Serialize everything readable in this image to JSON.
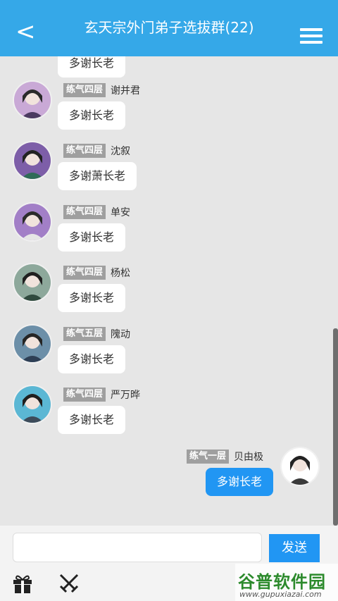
{
  "header": {
    "back": "<",
    "title": "玄天宗外门弟子选拔群(22)"
  },
  "partial_top_bubble": "多谢长老",
  "messages": [
    {
      "rank": "练气四层",
      "name": "谢并君",
      "text": "多谢长老"
    },
    {
      "rank": "练气四层",
      "name": "沈叙",
      "text": "多谢萧长老"
    },
    {
      "rank": "练气四层",
      "name": "单安",
      "text": "多谢长老"
    },
    {
      "rank": "练气四层",
      "name": "杨松",
      "text": "多谢长老"
    },
    {
      "rank": "练气五层",
      "name": "隗动",
      "text": "多谢长老"
    },
    {
      "rank": "练气四层",
      "name": "严万晔",
      "text": "多谢长老"
    },
    {
      "rank": "练气一层",
      "name": "贝由极",
      "text": "多谢长老",
      "self": true
    }
  ],
  "input": {
    "value": "",
    "placeholder": ""
  },
  "send_label": "发送",
  "tools": [
    "gift-icon",
    "crossed-swords-icon"
  ],
  "watermark": {
    "main": "谷普软件园",
    "url": "www.gupuxiazai.com"
  },
  "colors": {
    "header": "#35a8e8",
    "accent": "#2196f3",
    "rank_bg": "#9f9f9f"
  }
}
